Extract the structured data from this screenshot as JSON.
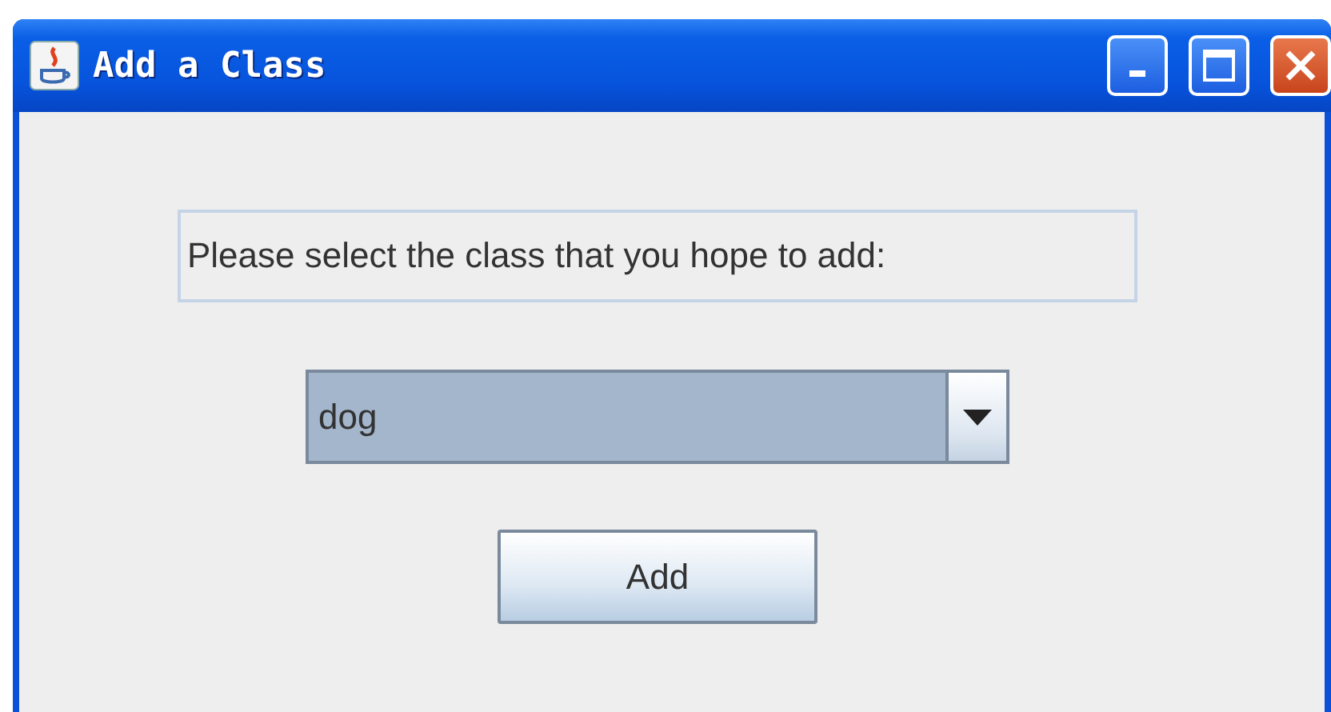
{
  "window": {
    "title": "Add a Class"
  },
  "prompt": "Please select the class that you hope to add:",
  "class_select": {
    "value": "dog"
  },
  "buttons": [
    "Add"
  ]
}
